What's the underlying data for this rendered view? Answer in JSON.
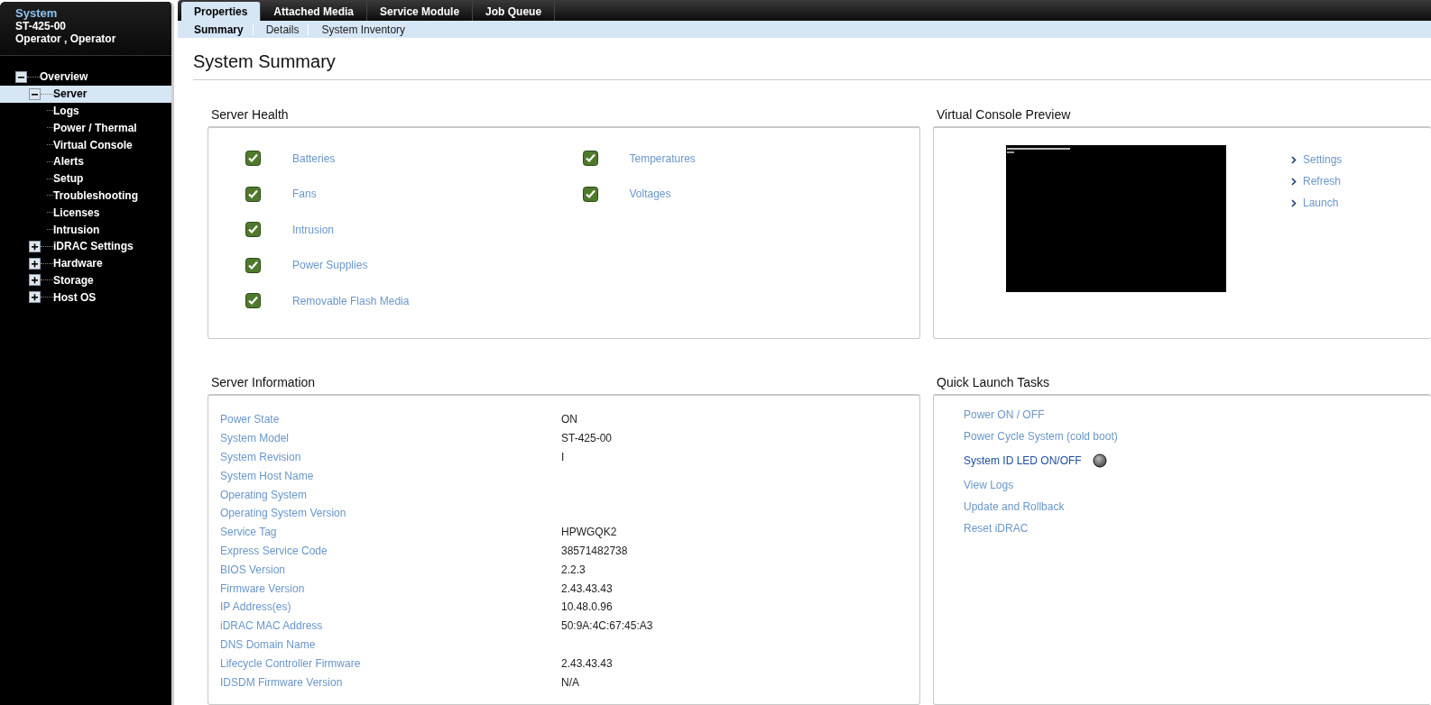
{
  "sidebar": {
    "title": "System",
    "model": "ST-425-00",
    "user": "Operator , Operator",
    "tree": [
      {
        "label": "Overview",
        "expanded": true,
        "selected": false,
        "children": [
          {
            "label": "Server",
            "expanded": true,
            "selected": true,
            "children": [
              {
                "label": "Logs",
                "selected": false
              },
              {
                "label": "Power / Thermal",
                "selected": false
              },
              {
                "label": "Virtual Console",
                "selected": false
              },
              {
                "label": "Alerts",
                "selected": false
              },
              {
                "label": "Setup",
                "selected": false
              },
              {
                "label": "Troubleshooting",
                "selected": false
              },
              {
                "label": "Licenses",
                "selected": false
              },
              {
                "label": "Intrusion",
                "selected": false
              }
            ]
          },
          {
            "label": "iDRAC Settings",
            "expanded": false,
            "selected": false
          },
          {
            "label": "Hardware",
            "expanded": false,
            "selected": false
          },
          {
            "label": "Storage",
            "expanded": false,
            "selected": false
          },
          {
            "label": "Host OS",
            "expanded": false,
            "selected": false
          }
        ]
      }
    ]
  },
  "tabs": [
    {
      "label": "Properties",
      "selected": true
    },
    {
      "label": "Attached Media",
      "selected": false
    },
    {
      "label": "Service Module",
      "selected": false
    },
    {
      "label": "Job Queue",
      "selected": false
    }
  ],
  "subtabs": [
    {
      "label": "Summary",
      "selected": true
    },
    {
      "label": "Details",
      "selected": false
    },
    {
      "label": "System Inventory",
      "selected": false
    }
  ],
  "page_title": "System Summary",
  "server_health": {
    "title": "Server Health",
    "columns": [
      [
        {
          "label": "Batteries",
          "ok": true
        },
        {
          "label": "Fans",
          "ok": true
        },
        {
          "label": "Intrusion",
          "ok": true
        },
        {
          "label": "Power Supplies",
          "ok": true
        },
        {
          "label": "Removable Flash Media",
          "ok": true
        }
      ],
      [
        {
          "label": "Temperatures",
          "ok": true
        },
        {
          "label": "Voltages",
          "ok": true
        }
      ]
    ]
  },
  "console_preview": {
    "title": "Virtual Console Preview",
    "preview": {
      "kind": "picture"
    },
    "links": [
      "Settings",
      "Refresh",
      "Launch"
    ]
  },
  "server_information": {
    "title": "Server Information",
    "rows": [
      {
        "label": "Power State",
        "value": "ON"
      },
      {
        "label": "System Model",
        "value": "ST-425-00"
      },
      {
        "label": "System Revision",
        "value": "I"
      },
      {
        "label": "System Host Name"
      },
      {
        "label": "Operating System"
      },
      {
        "label": "Operating System Version"
      },
      {
        "label": "Service Tag",
        "value": "HPWGQK2"
      },
      {
        "label": "Express Service Code",
        "value": "38571482738"
      },
      {
        "label": "BIOS Version",
        "value": "2.2.3"
      },
      {
        "label": "Firmware Version",
        "value": "2.43.43.43"
      },
      {
        "label": "IP Address(es)",
        "value": "10.48.0.96"
      },
      {
        "label": "iDRAC MAC Address",
        "value": "50:9A:4C:67:45:A3"
      },
      {
        "label": "DNS Domain Name"
      },
      {
        "label": "Lifecycle Controller Firmware",
        "value": "2.43.43.43"
      },
      {
        "label": "IDSDM Firmware Version",
        "value": "N/A"
      }
    ]
  },
  "quick_launch": {
    "title": "Quick Launch Tasks",
    "tasks": [
      {
        "label": "Power ON / OFF",
        "kind": "link"
      },
      {
        "label": "Power Cycle System (cold boot)",
        "kind": "link"
      },
      {
        "label": "System ID LED ON/OFF",
        "kind": "toggle",
        "on": false
      },
      {
        "label": "View Logs",
        "kind": "link"
      },
      {
        "label": "Update and Rollback",
        "kind": "link"
      },
      {
        "label": "Reset iDRAC",
        "kind": "link"
      }
    ]
  }
}
